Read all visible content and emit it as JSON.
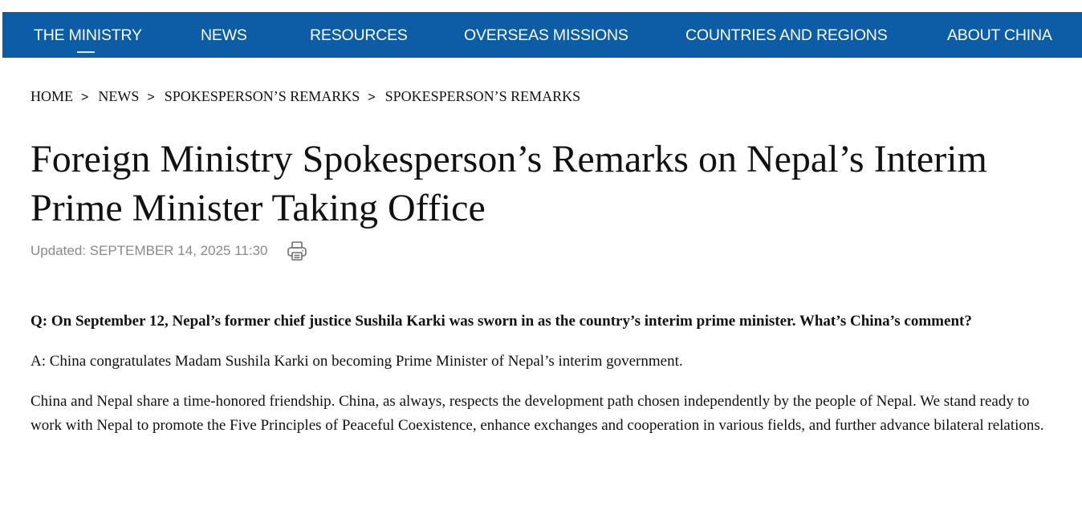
{
  "nav": {
    "items": [
      {
        "label": "THE MINISTRY"
      },
      {
        "label": "NEWS"
      },
      {
        "label": "RESOURCES"
      },
      {
        "label": "OVERSEAS MISSIONS"
      },
      {
        "label": "COUNTRIES AND REGIONS"
      },
      {
        "label": "ABOUT CHINA"
      }
    ],
    "active_index": 0,
    "background_color": "#0c5da5"
  },
  "breadcrumb": {
    "items": [
      {
        "label": "HOME"
      },
      {
        "label": "NEWS"
      },
      {
        "label": "SPOKESPERSON’S REMARKS"
      },
      {
        "label": "SPOKESPERSON’S REMARKS"
      }
    ],
    "separator": ">"
  },
  "article": {
    "title": "Foreign Ministry Spokesperson’s Remarks on Nepal’s Interim Prime Minister Taking Office",
    "updated": "Updated: SEPTEMBER 14, 2025 11:30",
    "print_icon": "printer-icon",
    "question": "Q: On September 12, Nepal’s former chief justice Sushila Karki was sworn in as the country’s interim prime minister. What’s China’s comment?",
    "answer": "A: China congratulates Madam Sushila Karki on becoming Prime Minister of Nepal’s interim government.",
    "paragraph": "China and Nepal share a time-honored friendship. China, as always, respects the development path chosen independently by the people of Nepal. We stand ready to work with Nepal to promote the Five Principles of Peaceful Coexistence, enhance exchanges and cooperation in various fields, and further advance bilateral relations."
  }
}
